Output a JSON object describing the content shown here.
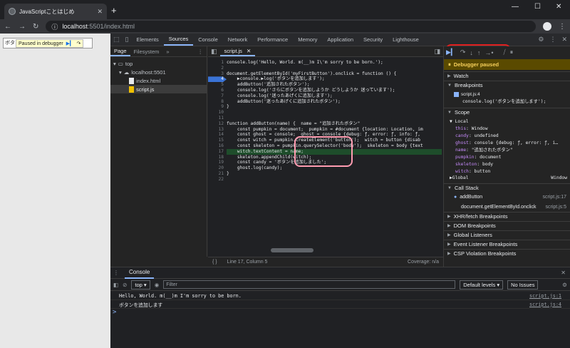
{
  "browser": {
    "tab_title": "JavaScriptことはじめ",
    "new_tab": "+",
    "address_host": "localhost",
    "address_path": ":5501/index.html"
  },
  "page": {
    "button_text": "ボタ",
    "paused_label": "Paused in debugger"
  },
  "devtools": {
    "tabs": [
      "Elements",
      "Sources",
      "Console",
      "Network",
      "Performance",
      "Memory",
      "Application",
      "Security",
      "Lighthouse"
    ],
    "active_tab": "Sources",
    "issues_count": "1"
  },
  "navigator": {
    "tabs": [
      "Page",
      "Filesystem"
    ],
    "tree": {
      "top": "top",
      "origin": "localhost:5501",
      "file1": "index.html",
      "file2": "script.js"
    }
  },
  "editor": {
    "tab": "script.js",
    "status_position": "Line 17, Column 5",
    "status_coverage": "Coverage: n/a",
    "lines": [
      {
        "n": "1",
        "t": "console.log('Hello, World. m(__)m I\\'m sorry to be born.');"
      },
      {
        "n": "2",
        "t": ""
      },
      {
        "n": "3",
        "t": "document.getElementById('myFirstButton').onclick = function () {"
      },
      {
        "n": "4",
        "t": "    ▶console.▶log('ボタンを追加します');"
      },
      {
        "n": "5",
        "t": "    addButton('追加されたボタン');"
      },
      {
        "n": "6",
        "t": "    console.log('さらにボタンを追加しようか どうしようか 迷っています');"
      },
      {
        "n": "7",
        "t": "    console.log('迷ったあげくに追加します');"
      },
      {
        "n": "8",
        "t": "    addButton('迷ったあげくに追加されたボタン');"
      },
      {
        "n": "9",
        "t": "}"
      },
      {
        "n": "10",
        "t": ""
      },
      {
        "n": "11",
        "t": ""
      },
      {
        "n": "12",
        "t": "function addButton(name) {  name = \"追加されたボタン\""
      },
      {
        "n": "13",
        "t": "    const pumpkin = document;  pumpkin = #document {location: Location, im"
      },
      {
        "n": "14",
        "t": "    const ghost = console;  ghost = console {debug: ƒ, error: ƒ, info: ƒ,"
      },
      {
        "n": "15",
        "t": "    const witch = pumpkin.createElement('button');  witch = button {disab"
      },
      {
        "n": "16",
        "t": "    const skeleton = pumpkin.querySelector('body');  skeleton = body {text"
      },
      {
        "n": "17",
        "t": "    witch.textContent = name;"
      },
      {
        "n": "18",
        "t": "    skeleton.appendChild(witch);"
      },
      {
        "n": "19",
        "t": "    const candy = 'ボタンを追加しました';"
      },
      {
        "n": "20",
        "t": "    ghost.log(candy);"
      },
      {
        "n": "21",
        "t": "}"
      },
      {
        "n": "22",
        "t": ""
      }
    ]
  },
  "debugger": {
    "paused": "Debugger paused",
    "watch": "Watch",
    "breakpoints": "Breakpoints",
    "bp_file": "script.js:4",
    "bp_code": "console.log('ボタンを追加します');",
    "scope": "Scope",
    "local": "Local",
    "scope_rows": [
      {
        "k": "this",
        "v": "Window"
      },
      {
        "k": "candy",
        "v": "undefined"
      },
      {
        "k": "ghost",
        "v": "console {debug: ƒ, error: ƒ, i…"
      },
      {
        "k": "name",
        "v": "\"追加されたボタン\""
      },
      {
        "k": "pumpkin",
        "v": "document"
      },
      {
        "k": "skeleton",
        "v": "body"
      },
      {
        "k": "witch",
        "v": "button"
      }
    ],
    "global": "Global",
    "global_val": "Window",
    "call_stack": "Call Stack",
    "frames": [
      {
        "fn": "addButton",
        "loc": "script.js:17"
      },
      {
        "fn": "document.getElementById.onclick",
        "loc": "script.js:5"
      }
    ],
    "more_sections": [
      "XHR/fetch Breakpoints",
      "DOM Breakpoints",
      "Global Listeners",
      "Event Listener Breakpoints",
      "CSP Violation Breakpoints"
    ]
  },
  "console": {
    "tab": "Console",
    "context": "top",
    "filter_placeholder": "Filter",
    "levels": "Default levels",
    "issues": "No Issues",
    "messages": [
      {
        "text": "Hello, World. m(__)m I'm sorry to be born.",
        "src": "script.js:1"
      },
      {
        "text": "ボタンを追加します",
        "src": "script.js:4"
      }
    ],
    "prompt": ">"
  }
}
